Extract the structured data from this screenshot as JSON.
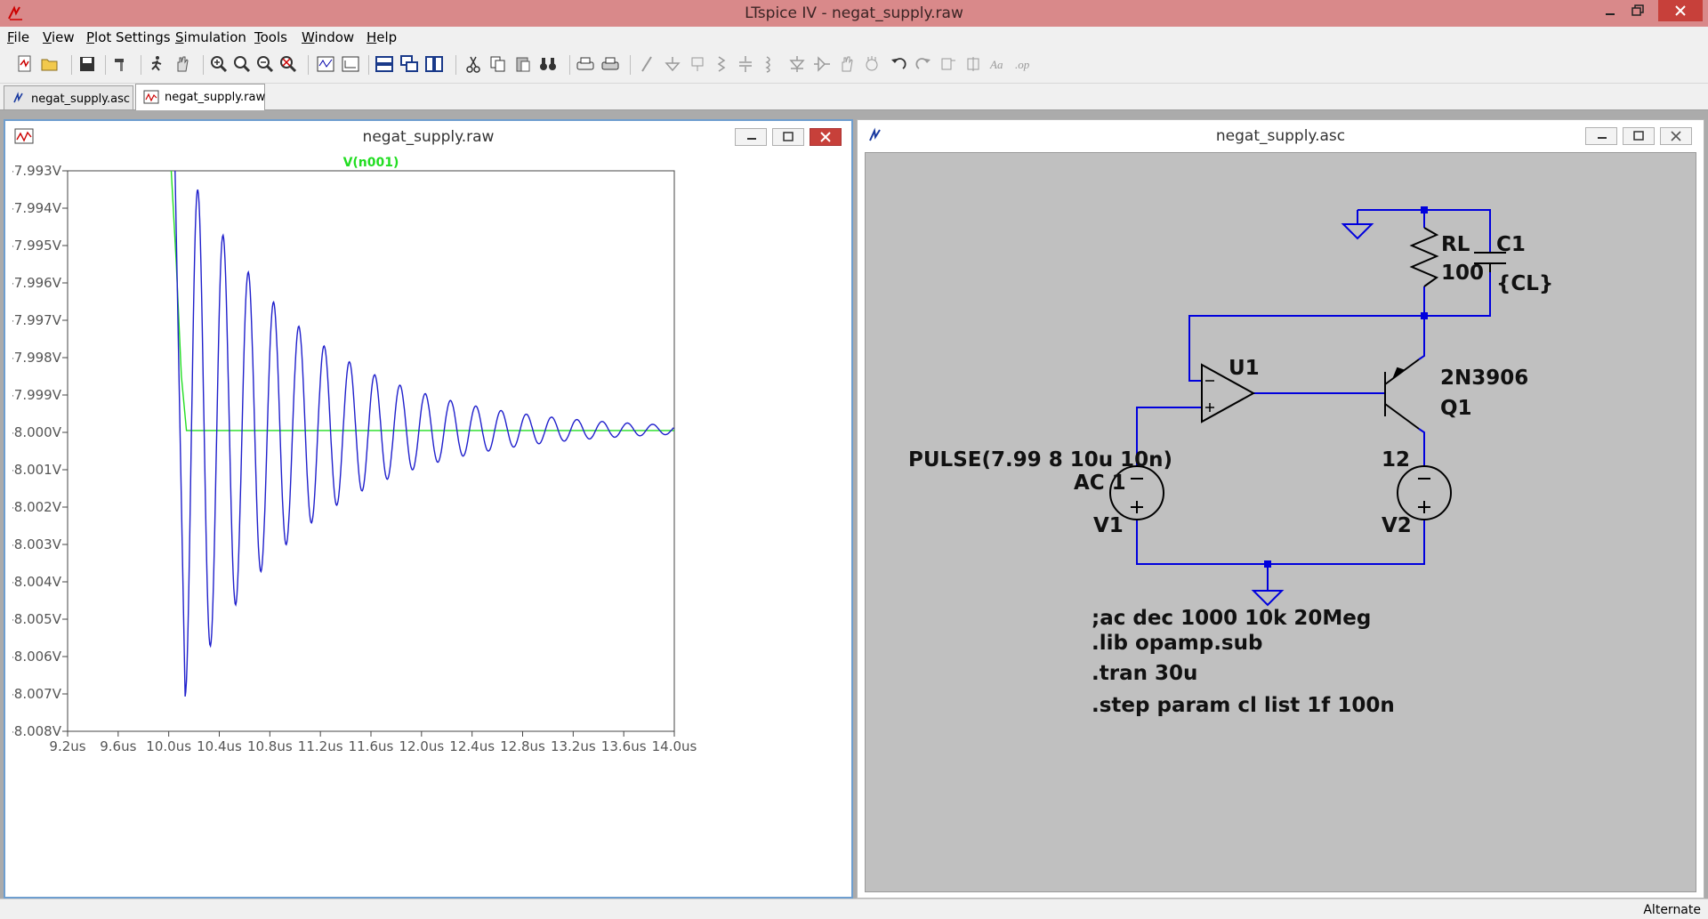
{
  "window": {
    "title": "LTspice IV - negat_supply.raw"
  },
  "menu": [
    "File",
    "View",
    "Plot Settings",
    "Simulation",
    "Tools",
    "Window",
    "Help"
  ],
  "tabs": [
    {
      "label": "negat_supply.asc",
      "icon": "schematic-icon",
      "active": false
    },
    {
      "label": "negat_supply.raw",
      "icon": "waveform-icon",
      "active": true
    }
  ],
  "waveform_window": {
    "title": "negat_supply.raw"
  },
  "schematic_window": {
    "title": "negat_supply.asc"
  },
  "chart_data": {
    "type": "line",
    "title": "",
    "xlabel": "",
    "ylabel": "",
    "xlim": [
      9.2,
      14.0
    ],
    "ylim": [
      -8.008,
      -7.993
    ],
    "x_unit": "us",
    "y_unit": "V",
    "x_ticks": [
      "9.2us",
      "9.6us",
      "10.0us",
      "10.4us",
      "10.8us",
      "11.2us",
      "11.6us",
      "12.0us",
      "12.4us",
      "12.8us",
      "13.2us",
      "13.6us",
      "14.0us"
    ],
    "y_ticks": [
      "-7.993V",
      "-7.994V",
      "-7.995V",
      "-7.996V",
      "-7.997V",
      "-7.998V",
      "-7.999V",
      "-8.000V",
      "-8.001V",
      "-8.002V",
      "-8.003V",
      "-8.004V",
      "-8.005V",
      "-8.006V",
      "-8.007V",
      "-8.008V"
    ],
    "legend": "V(n001)",
    "grid": false,
    "series": [
      {
        "label": "V(n001) step cl=1f",
        "color": "#22dd22",
        "x": [
          10.02,
          10.06,
          10.1,
          10.14,
          14.0
        ],
        "y": [
          -7.993,
          -7.9955,
          -7.9985,
          -7.99995,
          -7.99995
        ]
      },
      {
        "label": "V(n001) step cl=100n",
        "color": "#2020cc",
        "ringing": {
          "start_x": 10.05,
          "start_y": -7.993,
          "settle_y": -7.99993,
          "period_us": 0.2,
          "decay_tau_us": 0.95,
          "first_min_x": 10.13,
          "first_min_y": -8.00707,
          "first_max_x": 10.23,
          "first_max_y": -7.99515
        }
      }
    ]
  },
  "schematic": {
    "labels": {
      "rl_name": "RL",
      "rl_value": "100",
      "c1_name": "C1",
      "c1_value": "{CL}",
      "opamp_name": "U1",
      "q1_model": "2N3906",
      "q1_name": "Q1",
      "v1_spec": "PULSE(7.99 8 10u 10n)",
      "v1_ac": "AC 1",
      "v1_name": "V1",
      "v2_value": "12",
      "v2_name": "V2"
    },
    "directives": [
      ";ac dec 1000 10k 20Meg",
      ".lib opamp.sub",
      ".tran 30u",
      ".step param cl list 1f 100n"
    ]
  },
  "status": {
    "text": "Alternate"
  }
}
